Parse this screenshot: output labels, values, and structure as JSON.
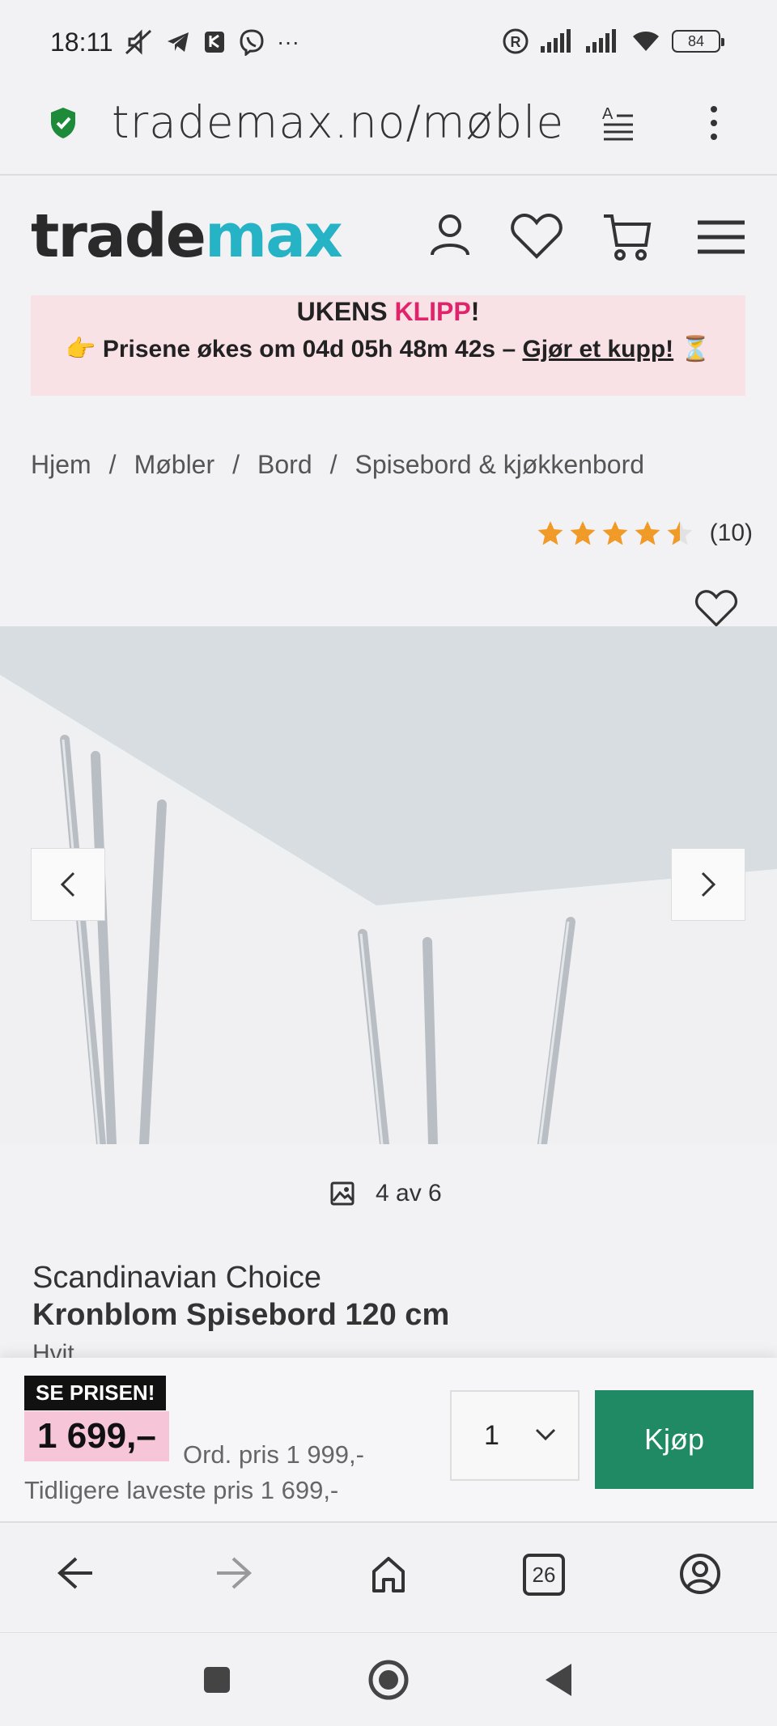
{
  "status_bar": {
    "time": "18:11",
    "left_icons": [
      "muted-icon",
      "telegram-icon",
      "shield-app-icon",
      "viber-icon",
      "more-icon"
    ],
    "more_label": "···",
    "battery": "84"
  },
  "url_bar": {
    "url": "trademax.no/møbler/"
  },
  "header": {
    "logo_dark": "trade",
    "logo_teal": "max",
    "colors": {
      "teal": "#26b3c6",
      "dark": "#2a2a2a"
    }
  },
  "promo": {
    "prefix": "UKENS ",
    "highlight": "KLIPP",
    "suffix": "!",
    "emoji_left": "👉",
    "text": " Prisene økes om 04d 05h 48m 42s – ",
    "link": "Gjør et kupp!",
    "emoji_right": " ⏳",
    "colors": {
      "background": "#f8e2e6",
      "highlight": "#e0246c"
    }
  },
  "breadcrumb": {
    "items": [
      "Hjem",
      "Møbler",
      "Bord",
      "Spisebord & kjøkkenbord"
    ],
    "separator": "/"
  },
  "rating": {
    "stars": 4.5,
    "count": "(10)"
  },
  "gallery": {
    "counter": "4 av 6"
  },
  "product": {
    "brand": "Scandinavian Choice",
    "name": "Kronblom Spisebord 120 cm",
    "color": "Hvit"
  },
  "buy_bar": {
    "badge": "SE PRISEN!",
    "price": "1 699,–",
    "ordinary_price": "Ord. pris 1 999,-",
    "lowest_price": "Tidligere laveste pris 1 699,-",
    "quantity": "1",
    "buy_label": "Kjøp",
    "colors": {
      "buy": "#1f8a63",
      "price_bg": "#f6c6d8"
    }
  },
  "browser_nav": {
    "tab_count": "26"
  }
}
